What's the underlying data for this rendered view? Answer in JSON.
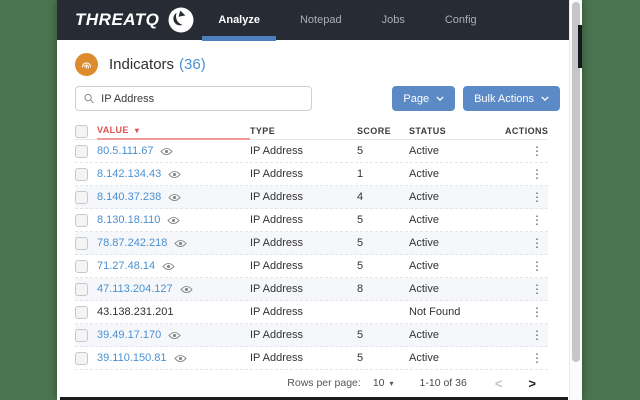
{
  "colors": {
    "desktop_bg": "#4a7450",
    "navbar_bg": "#262b34",
    "accent_blue": "#5b8ac6",
    "link_blue": "#4a90d2",
    "tab_underline_blue": "#4c7fc0",
    "danger_red": "#e25050",
    "orange": "#dd8b2c",
    "row_stripe": "#f5f7fa"
  },
  "navbar": {
    "brand": "THREATQ",
    "items": [
      {
        "label": "Analyze",
        "active": true
      },
      {
        "label": "Notepad",
        "active": false
      },
      {
        "label": "Jobs",
        "active": false
      },
      {
        "label": "Config",
        "active": false
      }
    ]
  },
  "header": {
    "title": "Indicators",
    "count": "(36)"
  },
  "toolbar": {
    "search": {
      "value": "IP Address"
    },
    "page_button": "Page",
    "bulk_actions_button": "Bulk Actions"
  },
  "table": {
    "columns": [
      "VALUE",
      "TYPE",
      "SCORE",
      "STATUS",
      "ACTIONS"
    ],
    "sorted_column": "VALUE",
    "sort_direction": "desc",
    "sort_icon": "▾",
    "rows": [
      {
        "value": "80.5.111.67",
        "link": true,
        "eye": true,
        "type": "IP Address",
        "score": "5",
        "status": "Active",
        "actions_icon": "⋮"
      },
      {
        "value": "8.142.134.43",
        "link": true,
        "eye": true,
        "type": "IP Address",
        "score": "1",
        "status": "Active",
        "actions_icon": "⋮"
      },
      {
        "value": "8.140.37.238",
        "link": true,
        "eye": true,
        "type": "IP Address",
        "score": "4",
        "status": "Active",
        "actions_icon": "⋮"
      },
      {
        "value": "8.130.18.110",
        "link": true,
        "eye": true,
        "type": "IP Address",
        "score": "5",
        "status": "Active",
        "actions_icon": "⋮"
      },
      {
        "value": "78.87.242.218",
        "link": true,
        "eye": true,
        "type": "IP Address",
        "score": "5",
        "status": "Active",
        "actions_icon": "⋮"
      },
      {
        "value": "71.27.48.14",
        "link": true,
        "eye": true,
        "type": "IP Address",
        "score": "5",
        "status": "Active",
        "actions_icon": "⋮"
      },
      {
        "value": "47.113.204.127",
        "link": true,
        "eye": true,
        "type": "IP Address",
        "score": "8",
        "status": "Active",
        "actions_icon": "⋮"
      },
      {
        "value": "43.138.231.201",
        "link": false,
        "eye": false,
        "type": "IP Address",
        "score": "",
        "status": "Not Found",
        "actions_icon": "⋮"
      },
      {
        "value": "39.49.17.170",
        "link": true,
        "eye": true,
        "type": "IP Address",
        "score": "5",
        "status": "Active",
        "actions_icon": "⋮"
      },
      {
        "value": "39.110.150.81",
        "link": true,
        "eye": true,
        "type": "IP Address",
        "score": "5",
        "status": "Active",
        "actions_icon": "⋮"
      }
    ]
  },
  "footer": {
    "rows_per_page_label": "Rows per page:",
    "rows_per_page_value": "10",
    "rows_caret_icon": "▾",
    "range": "1-10 of 36",
    "prev_icon": "<",
    "next_icon": ">"
  }
}
